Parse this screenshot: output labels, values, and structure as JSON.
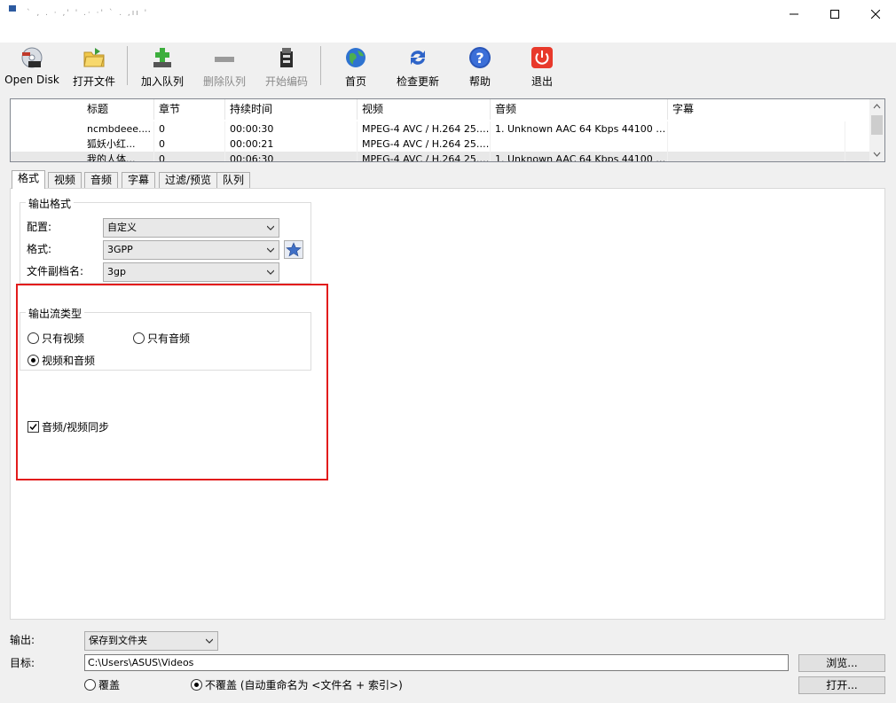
{
  "window": {
    "title": "\u0000",
    "title_scribble": "` , . · ,' ' .· ·' ` . ,ıı '"
  },
  "toolbar": {
    "items": [
      {
        "label": "Open Disk",
        "icon": "disc-icon"
      },
      {
        "label": "打开文件",
        "icon": "folder-icon"
      },
      {
        "label": "加入队列",
        "icon": "add-queue-icon"
      },
      {
        "label": "删除队列",
        "icon": "remove-queue-icon",
        "disabled": true
      },
      {
        "label": "开始编码",
        "icon": "encode-icon",
        "disabled": true
      },
      {
        "label": "首页",
        "icon": "globe-icon"
      },
      {
        "label": "检查更新",
        "icon": "refresh-icon"
      },
      {
        "label": "帮助",
        "icon": "help-icon"
      },
      {
        "label": "退出",
        "icon": "power-icon"
      }
    ]
  },
  "source_list": {
    "columns": [
      "标题",
      "章节",
      "持续时间",
      "视频",
      "音频",
      "字幕"
    ],
    "rows": [
      [
        "ncmbdeee....",
        "0",
        "00:00:30",
        "MPEG-4 AVC / H.264 25.0...",
        "1. Unknown AAC  64 Kbps 44100 Hz ...",
        ""
      ],
      [
        "狐妖小红...",
        "0",
        "00:00:21",
        "MPEG-4 AVC / H.264 25.0...",
        "",
        ""
      ],
      [
        "我的人体...",
        "0",
        "00:06:30",
        "MPEG-4 AVC / H.264 25.0...",
        "1. Unknown AAC  64 Kbps 44100 Hz ...",
        ""
      ]
    ]
  },
  "tabs": [
    "格式",
    "视频",
    "音频",
    "字幕",
    "过滤/预览",
    "队列"
  ],
  "format_tab": {
    "output_format_group": "输出格式",
    "config_label": "配置:",
    "config_value": "自定义",
    "format_label": "格式:",
    "format_value": "3GPP",
    "ext_label": "文件副档名:",
    "ext_value": "3gp",
    "stream_group": "输出流类型",
    "radio_video_only": "只有视频",
    "radio_audio_only": "只有音频",
    "radio_video_audio": "视频和音频",
    "sync_checkbox": "音频/视频同步"
  },
  "bottom": {
    "output_label": "输出:",
    "output_value": "保存到文件夹",
    "target_label": "目标:",
    "target_value": "C:\\Users\\ASUS\\Videos",
    "browse_button": "浏览...",
    "open_button": "打开...",
    "overwrite_radio": "覆盖",
    "no_overwrite_radio": "不覆盖 (自动重命名为 <文件名 + 索引>)"
  },
  "colors": {
    "highlight": "#e21c1c",
    "accent_blue": "#2e64c8",
    "exit_red": "#e8392b"
  }
}
